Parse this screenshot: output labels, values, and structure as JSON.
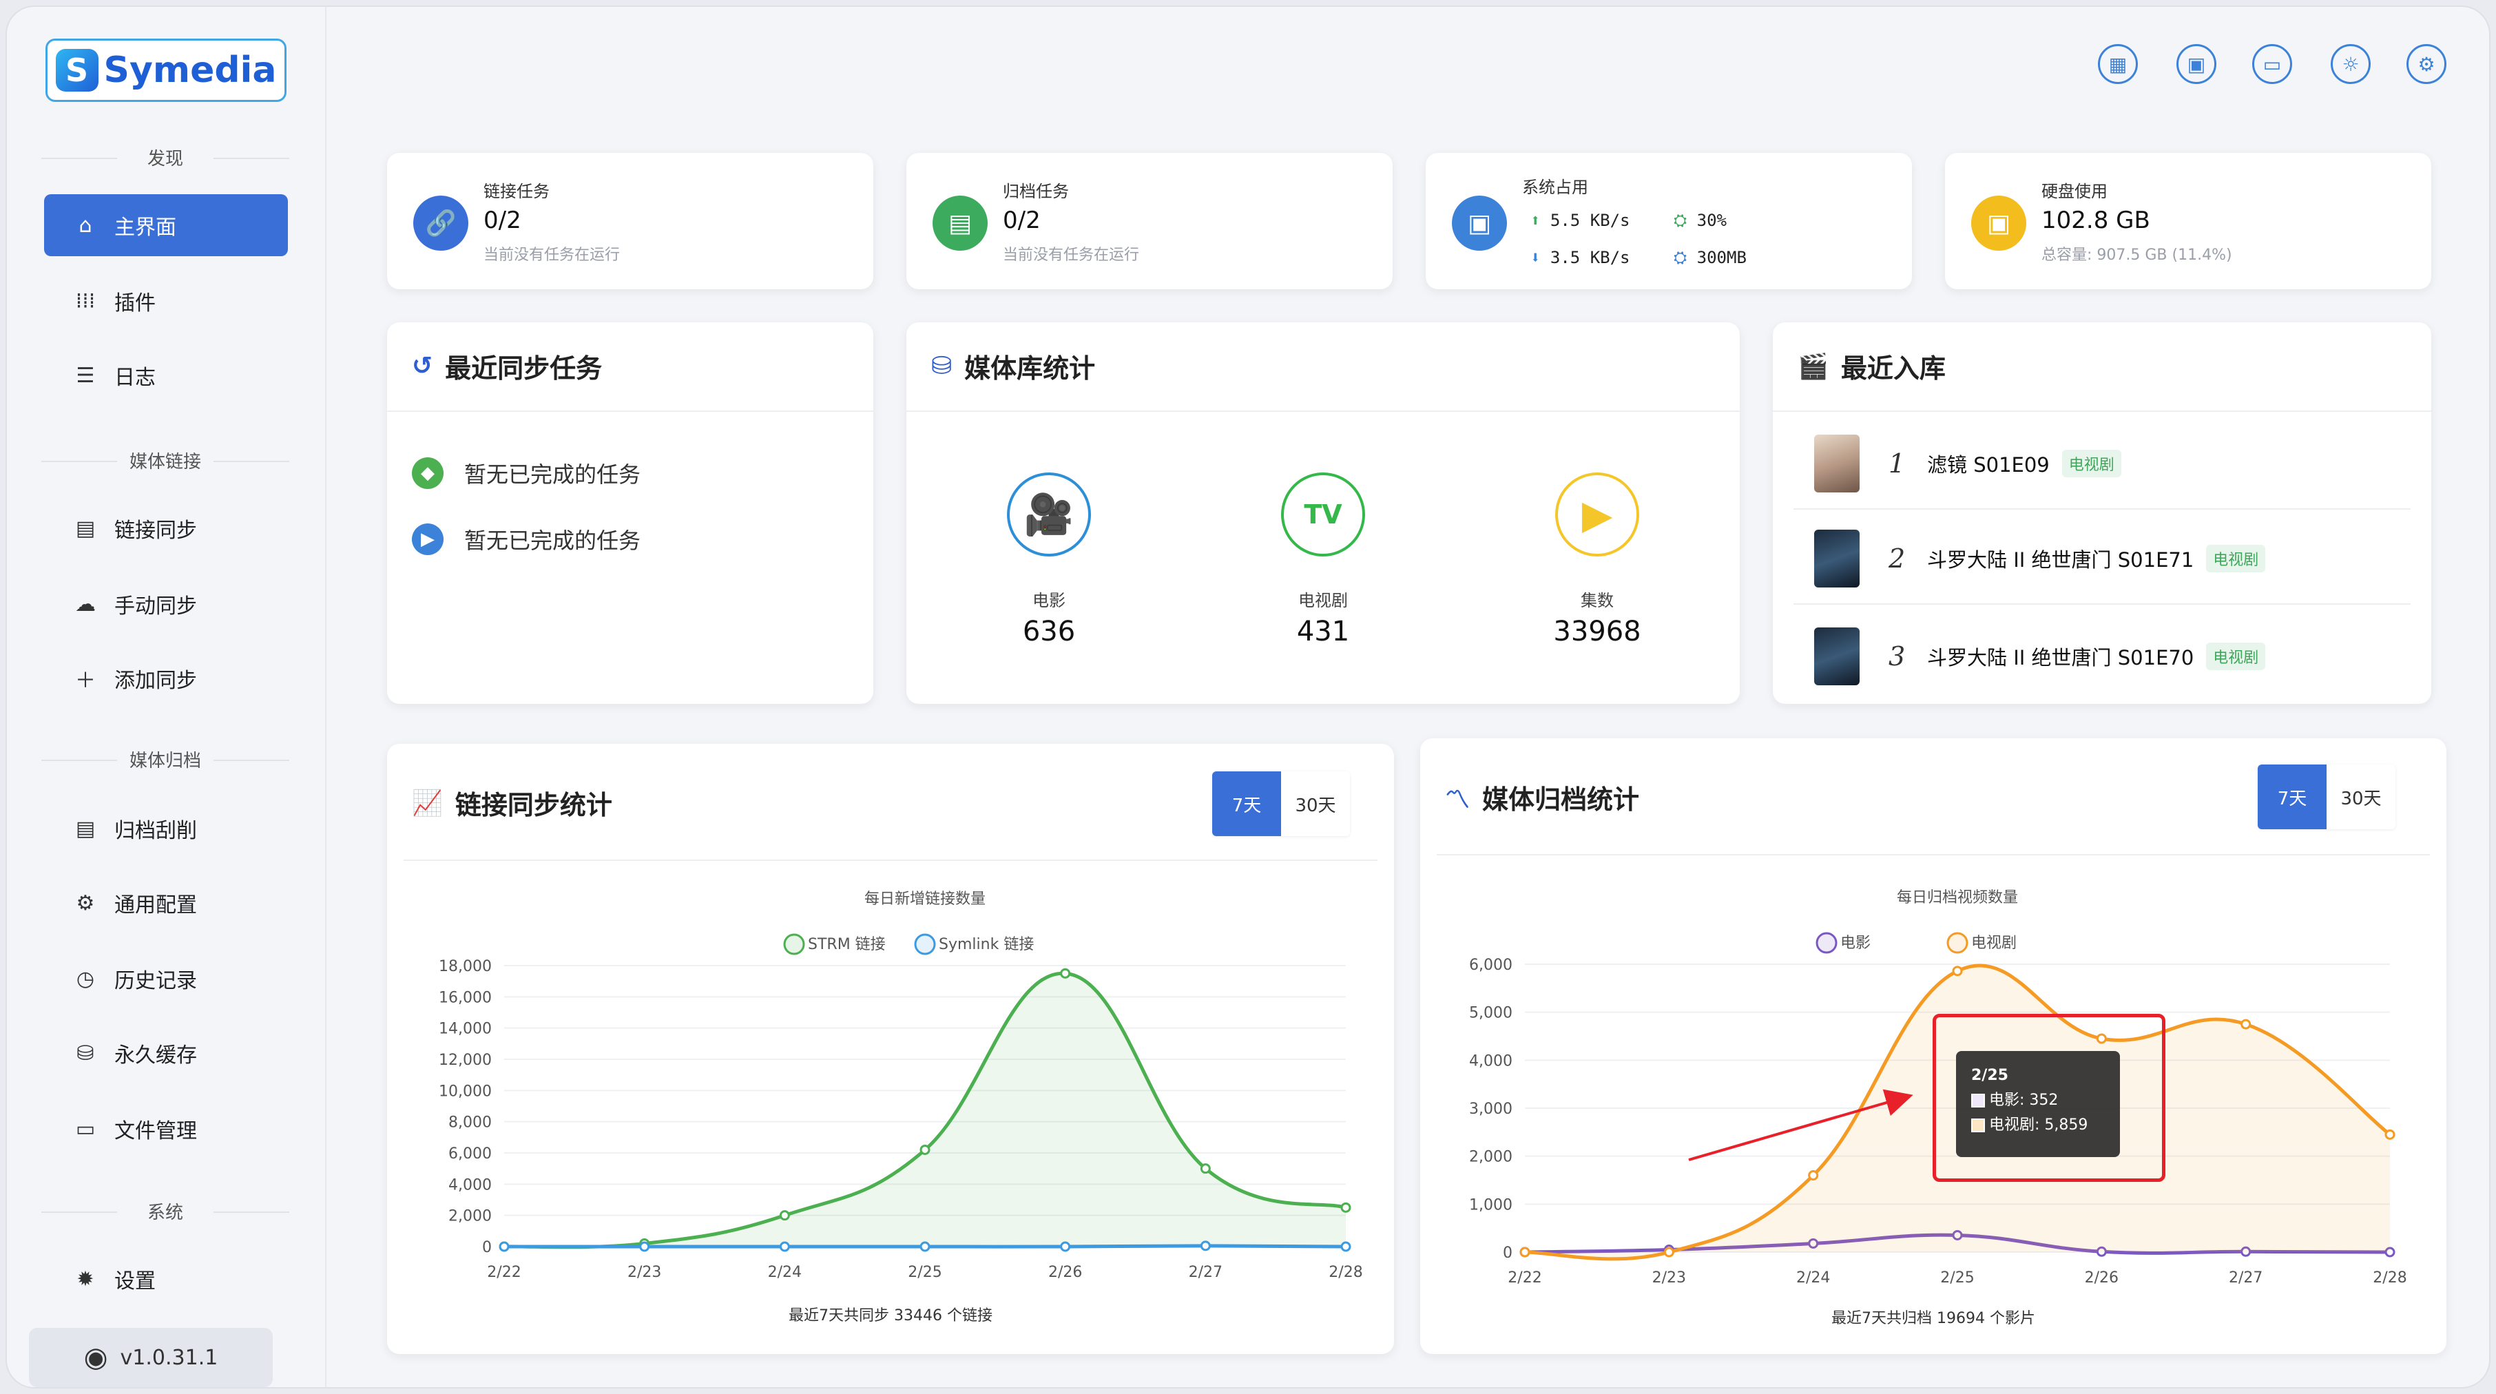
{
  "app": {
    "logo_text": "Symedia",
    "version": "v1.0.31.1"
  },
  "sidebar": {
    "sections": [
      "发现",
      "媒体链接",
      "媒体归档",
      "系统"
    ],
    "items": [
      {
        "label": "主界面",
        "icon": "home-icon"
      },
      {
        "label": "插件",
        "icon": "grid-icon"
      },
      {
        "label": "日志",
        "icon": "list-icon"
      },
      {
        "label": "链接同步",
        "icon": "table-icon"
      },
      {
        "label": "手动同步",
        "icon": "cloud-sync-icon"
      },
      {
        "label": "添加同步",
        "icon": "plus-icon"
      },
      {
        "label": "归档刮削",
        "icon": "table-icon"
      },
      {
        "label": "通用配置",
        "icon": "gear-icon"
      },
      {
        "label": "历史记录",
        "icon": "clock-icon"
      },
      {
        "label": "永久缓存",
        "icon": "database-icon"
      },
      {
        "label": "文件管理",
        "icon": "folder-icon"
      },
      {
        "label": "设置",
        "icon": "settings-icon"
      }
    ]
  },
  "stats": {
    "link_tasks": {
      "label": "链接任务",
      "value": "0/2",
      "sub": "当前没有任务在运行"
    },
    "archive_tasks": {
      "label": "归档任务",
      "value": "0/2",
      "sub": "当前没有任务在运行"
    },
    "system": {
      "label": "系统占用",
      "up": "5.5 KB/s",
      "down": "3.5 KB/s",
      "cpu": "30%",
      "mem": "300MB"
    },
    "disk": {
      "label": "硬盘使用",
      "value": "102.8 GB",
      "sub": "总容量: 907.5 GB (11.4%)"
    }
  },
  "recent_sync": {
    "title": "最近同步任务",
    "rows": [
      "暂无已完成的任务",
      "暂无已完成的任务"
    ]
  },
  "library": {
    "title": "媒体库统计",
    "items": [
      {
        "label": "电影",
        "value": "636"
      },
      {
        "label": "电视剧",
        "value": "431"
      },
      {
        "label": "集数",
        "value": "33968"
      }
    ]
  },
  "recent_added": {
    "title": "最近入库",
    "items": [
      {
        "rank": "1",
        "title": "滤镜 S01E09",
        "tag": "电视剧"
      },
      {
        "rank": "2",
        "title": "斗罗大陆 II 绝世唐门 S01E71",
        "tag": "电视剧"
      },
      {
        "rank": "3",
        "title": "斗罗大陆 II 绝世唐门 S01E70",
        "tag": "电视剧"
      }
    ]
  },
  "link_chart": {
    "title": "链接同步统计",
    "range_7": "7天",
    "range_30": "30天",
    "footer_prefix": "最近7天共同步",
    "footer_count": "33446",
    "footer_suffix": "个链接"
  },
  "archive_chart": {
    "title": "媒体归档统计",
    "range_7": "7天",
    "range_30": "30天",
    "footer_prefix": "最近7天共归档",
    "footer_count": "19694",
    "footer_suffix": "个影片",
    "tooltip": {
      "date": "2/25",
      "movie": "电影: 352",
      "tv": "电视剧: 5,859"
    }
  },
  "chart_data": [
    {
      "type": "line",
      "title": "每日新增链接数量",
      "x": [
        "2/22",
        "2/23",
        "2/24",
        "2/25",
        "2/26",
        "2/27",
        "2/28"
      ],
      "series": [
        {
          "name": "STRM 链接",
          "values": [
            0,
            200,
            2000,
            6200,
            17500,
            5000,
            2500
          ],
          "color": "#4caf50"
        },
        {
          "name": "Symlink 链接",
          "values": [
            0,
            0,
            0,
            0,
            0,
            50,
            0
          ],
          "color": "#3b9ae0"
        }
      ],
      "ylim": [
        0,
        18000
      ],
      "yticks": [
        "0",
        "2,000",
        "4,000",
        "6,000",
        "8,000",
        "10,000",
        "12,000",
        "14,000",
        "16,000",
        "18,000"
      ],
      "legend": "top"
    },
    {
      "type": "line",
      "title": "每日归档视频数量",
      "x": [
        "2/22",
        "2/23",
        "2/24",
        "2/25",
        "2/26",
        "2/27",
        "2/28"
      ],
      "series": [
        {
          "name": "电影",
          "values": [
            0,
            50,
            180,
            352,
            10,
            10,
            0
          ],
          "color": "#7b57c4"
        },
        {
          "name": "电视剧",
          "values": [
            0,
            0,
            1600,
            5859,
            4450,
            4750,
            2450
          ],
          "color": "#f59a23"
        }
      ],
      "ylim": [
        0,
        6000
      ],
      "yticks": [
        "0",
        "1,000",
        "2,000",
        "3,000",
        "4,000",
        "5,000",
        "6,000"
      ],
      "legend": "top"
    }
  ]
}
